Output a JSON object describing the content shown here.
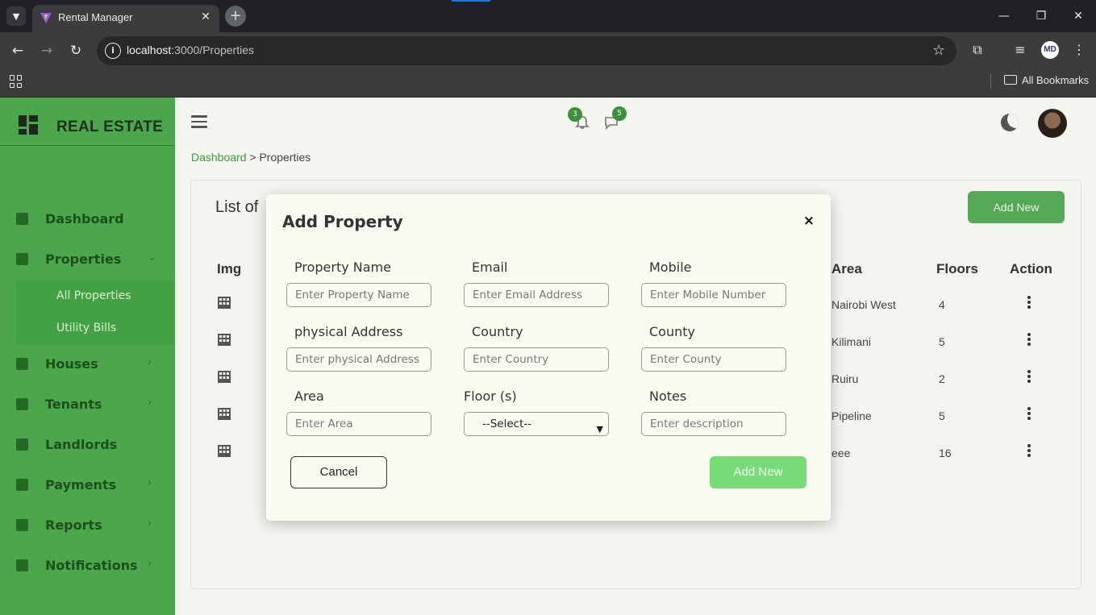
{
  "browser": {
    "tab_title": "Rental Manager",
    "url_host": "localhost",
    "url_path": ":3000/Properties",
    "bookmarks_label": "All Bookmarks",
    "profile_initials": "MD"
  },
  "sidebar": {
    "brand": "REAL ESTATE",
    "items": [
      {
        "label": "Dashboard"
      },
      {
        "label": "Properties"
      },
      {
        "label": "Houses"
      },
      {
        "label": "Tenants"
      },
      {
        "label": "Landlords"
      },
      {
        "label": "Payments"
      },
      {
        "label": "Reports"
      },
      {
        "label": "Notifications"
      }
    ],
    "properties_sub": [
      "All Properties",
      "Utility Bills"
    ]
  },
  "header": {
    "notifications_count": "3",
    "messages_count": "5"
  },
  "breadcrumb": {
    "home": "Dashboard",
    "separator": ">",
    "current": "Properties"
  },
  "card": {
    "title": "List of",
    "add_button": "Add New",
    "columns": {
      "img": "Img",
      "area": "Area",
      "floors": "Floors",
      "action": "Action"
    },
    "rows": [
      {
        "area": "Nairobi West",
        "floors": "4"
      },
      {
        "area": "Kilimani",
        "floors": "5"
      },
      {
        "area": "Ruiru",
        "floors": "2"
      },
      {
        "area": "Pipeline",
        "floors": "5"
      },
      {
        "area": "eee",
        "floors": "16"
      }
    ]
  },
  "modal": {
    "title": "Add Property",
    "close": "×",
    "fields": {
      "property_name": {
        "label": "Property Name",
        "placeholder": "Enter Property Name"
      },
      "email": {
        "label": "Email",
        "placeholder": "Enter Email Address"
      },
      "mobile": {
        "label": "Mobile",
        "placeholder": "Enter Mobile Number"
      },
      "physical_address": {
        "label": "physical Address",
        "placeholder": "Enter physical Address"
      },
      "country": {
        "label": "Country",
        "placeholder": "Enter Country"
      },
      "county": {
        "label": "County",
        "placeholder": "Enter County"
      },
      "area": {
        "label": "Area",
        "placeholder": "Enter Area"
      },
      "floors": {
        "label": "Floor (s)",
        "selected": "--Select--"
      },
      "notes": {
        "label": "Notes",
        "placeholder": "Enter description"
      }
    },
    "cancel_label": "Cancel",
    "submit_label": "Add New"
  },
  "colors": {
    "sidebar_green": "#4ca64c",
    "accent_green": "#3b9a3b",
    "submit_green": "#77dc77"
  }
}
